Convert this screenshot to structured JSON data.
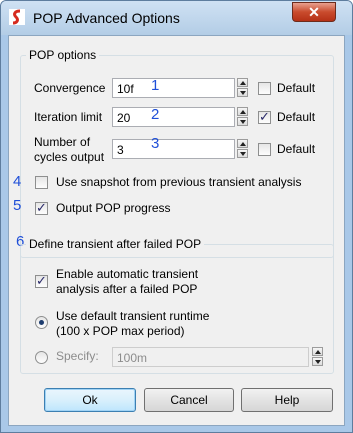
{
  "window": {
    "title": "POP Advanced Options"
  },
  "pop_options": {
    "legend": "POP options",
    "convergence": {
      "label": "Convergence",
      "value": "10f",
      "default_label": "Default",
      "default_checked": false,
      "marker": "1"
    },
    "iteration_limit": {
      "label": "Iteration limit",
      "value": "20",
      "default_label": "Default",
      "default_checked": true,
      "marker": "2"
    },
    "cycles_output": {
      "label_line1": "Number of",
      "label_line2": "cycles output",
      "value": "3",
      "default_label": "Default",
      "default_checked": false,
      "marker": "3"
    },
    "use_snapshot": {
      "label": "Use snapshot from previous transient analysis",
      "checked": false,
      "marker": "4"
    },
    "output_progress": {
      "label": "Output POP progress",
      "checked": true,
      "marker": "5"
    }
  },
  "transient": {
    "legend": "Define transient after failed POP",
    "marker": "6",
    "enable_auto": {
      "line1": "Enable automatic transient",
      "line2": "analysis after a failed POP",
      "checked": true
    },
    "use_default": {
      "line1": "Use default transient runtime",
      "line2": "(100 x POP max period)",
      "selected": true
    },
    "specify": {
      "label": "Specify:",
      "value": "100m",
      "selected": false
    }
  },
  "buttons": {
    "ok": "Ok",
    "cancel": "Cancel",
    "help": "Help"
  },
  "colors": {
    "marker": "#1f4fd8",
    "titlebar": "#b3cde6",
    "close": "#c94b2d"
  }
}
